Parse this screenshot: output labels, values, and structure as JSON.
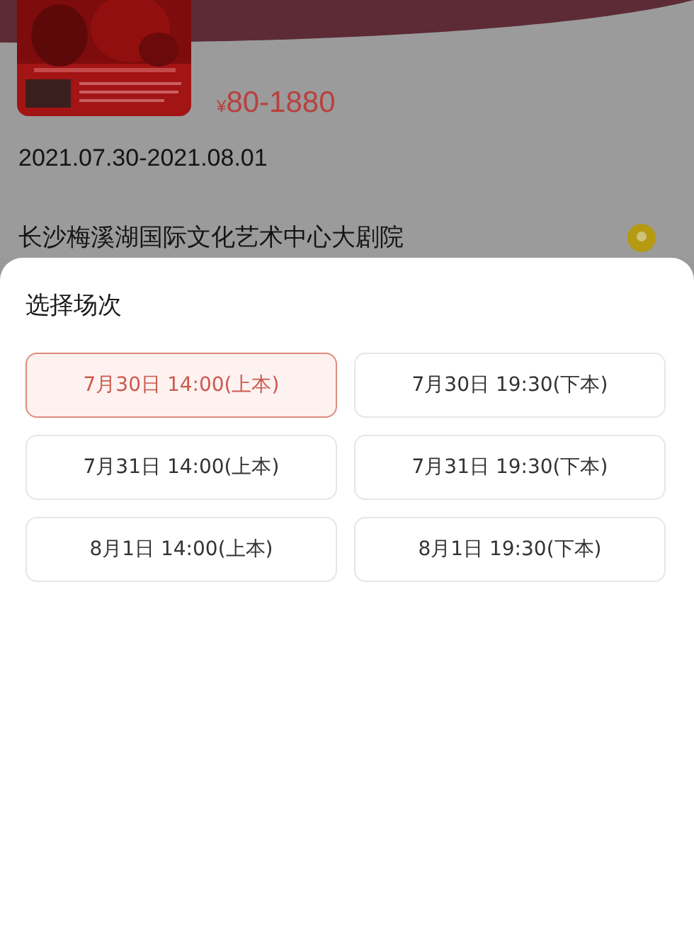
{
  "event": {
    "price_symbol": "¥",
    "price": "80-1880",
    "dates": "2021.07.30-2021.08.01",
    "venue": "长沙梅溪湖国际文化艺术中心大剧院"
  },
  "sheet": {
    "title": "选择场次",
    "sessions": [
      {
        "label": "7月30日 14:00(上本)",
        "selected": true
      },
      {
        "label": "7月30日 19:30(下本)",
        "selected": false
      },
      {
        "label": "7月31日 14:00(上本)",
        "selected": false
      },
      {
        "label": "7月31日 19:30(下本)",
        "selected": false
      },
      {
        "label": "8月1日 14:00(上本)",
        "selected": false
      },
      {
        "label": "8月1日 19:30(下本)",
        "selected": false
      }
    ]
  }
}
